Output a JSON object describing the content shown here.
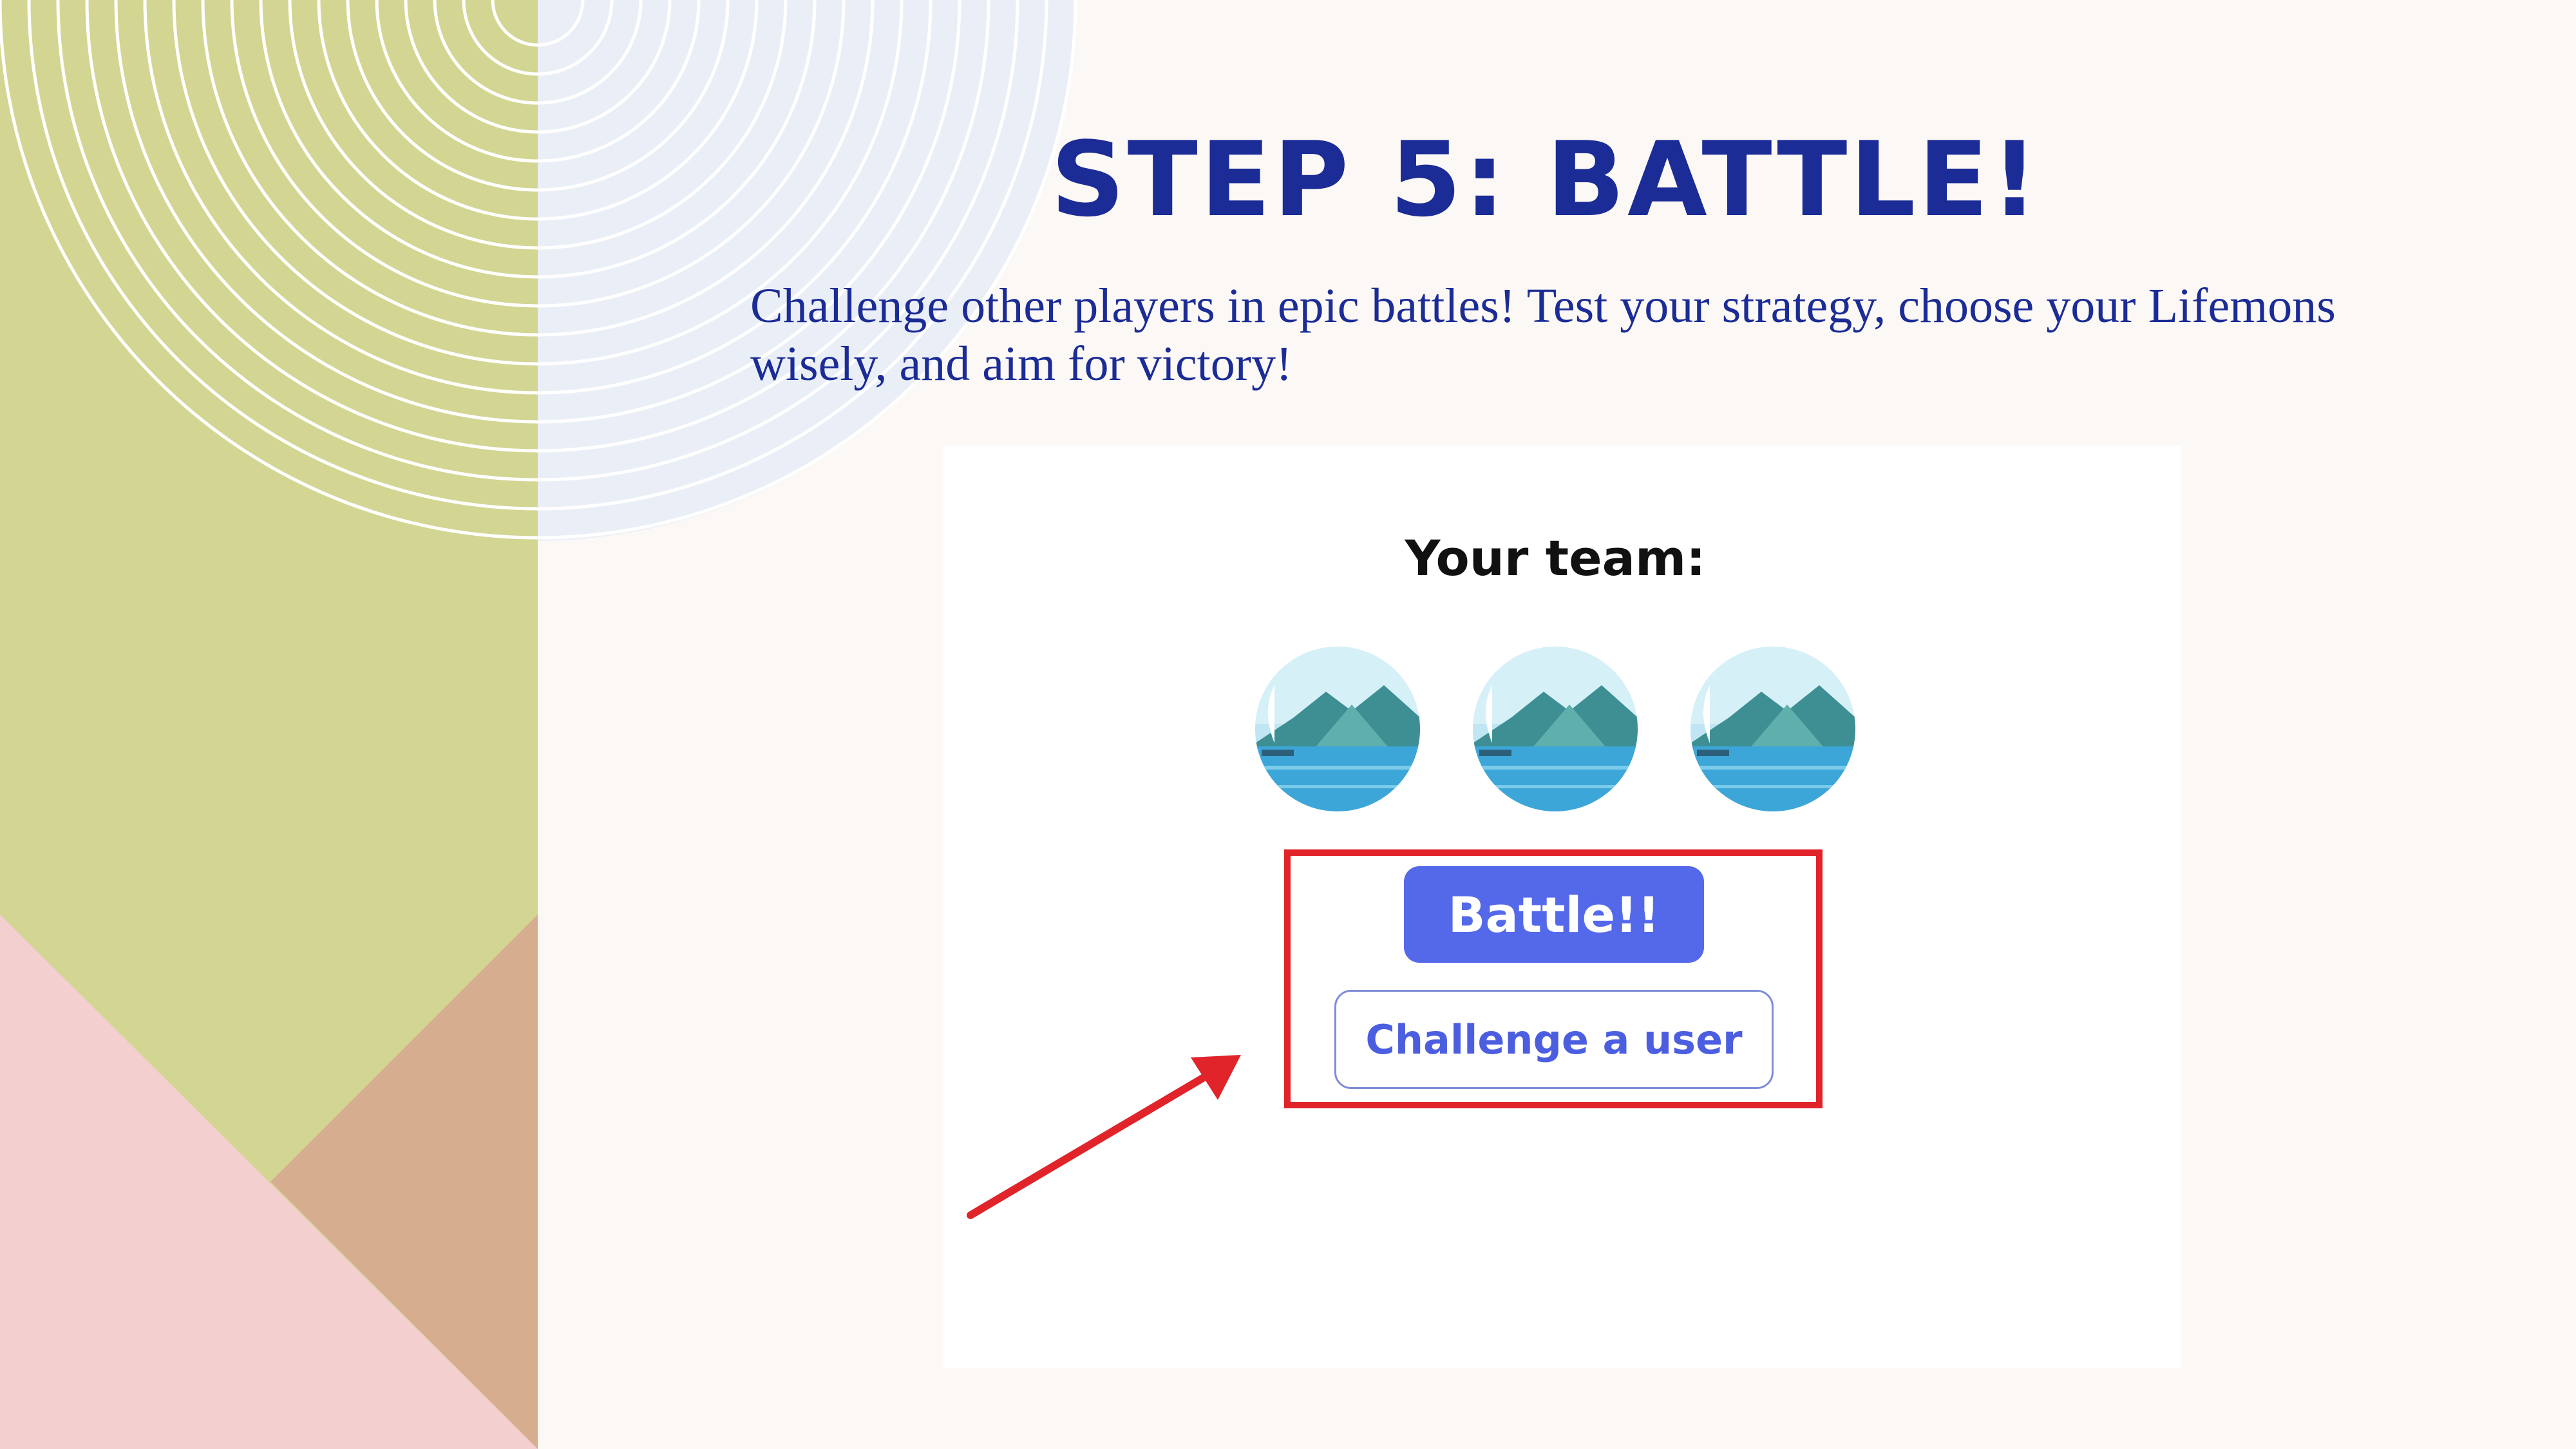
{
  "slide": {
    "title": "STEP 5: BATTLE!",
    "description": "Challenge other players in epic battles! Test your strategy, choose your Lifemons wisely, and aim for victory!"
  },
  "screenshot": {
    "team_label": "Your team:",
    "team_avatars": [
      {
        "icon": "lake-landscape-avatar"
      },
      {
        "icon": "lake-landscape-avatar"
      },
      {
        "icon": "lake-landscape-avatar"
      }
    ],
    "battle_button": "Battle!!",
    "challenge_button": "Challenge a user",
    "highlight_color": "#e0242a",
    "arrow_color": "#e0242a"
  },
  "colors": {
    "title_text": "#1b2c96",
    "accent_button": "#5469ea",
    "panel_green": "#d3d592",
    "panel_pink": "#f3cfcf",
    "panel_tan": "#d6ad8e",
    "circle_blue": "#eaeff7"
  }
}
